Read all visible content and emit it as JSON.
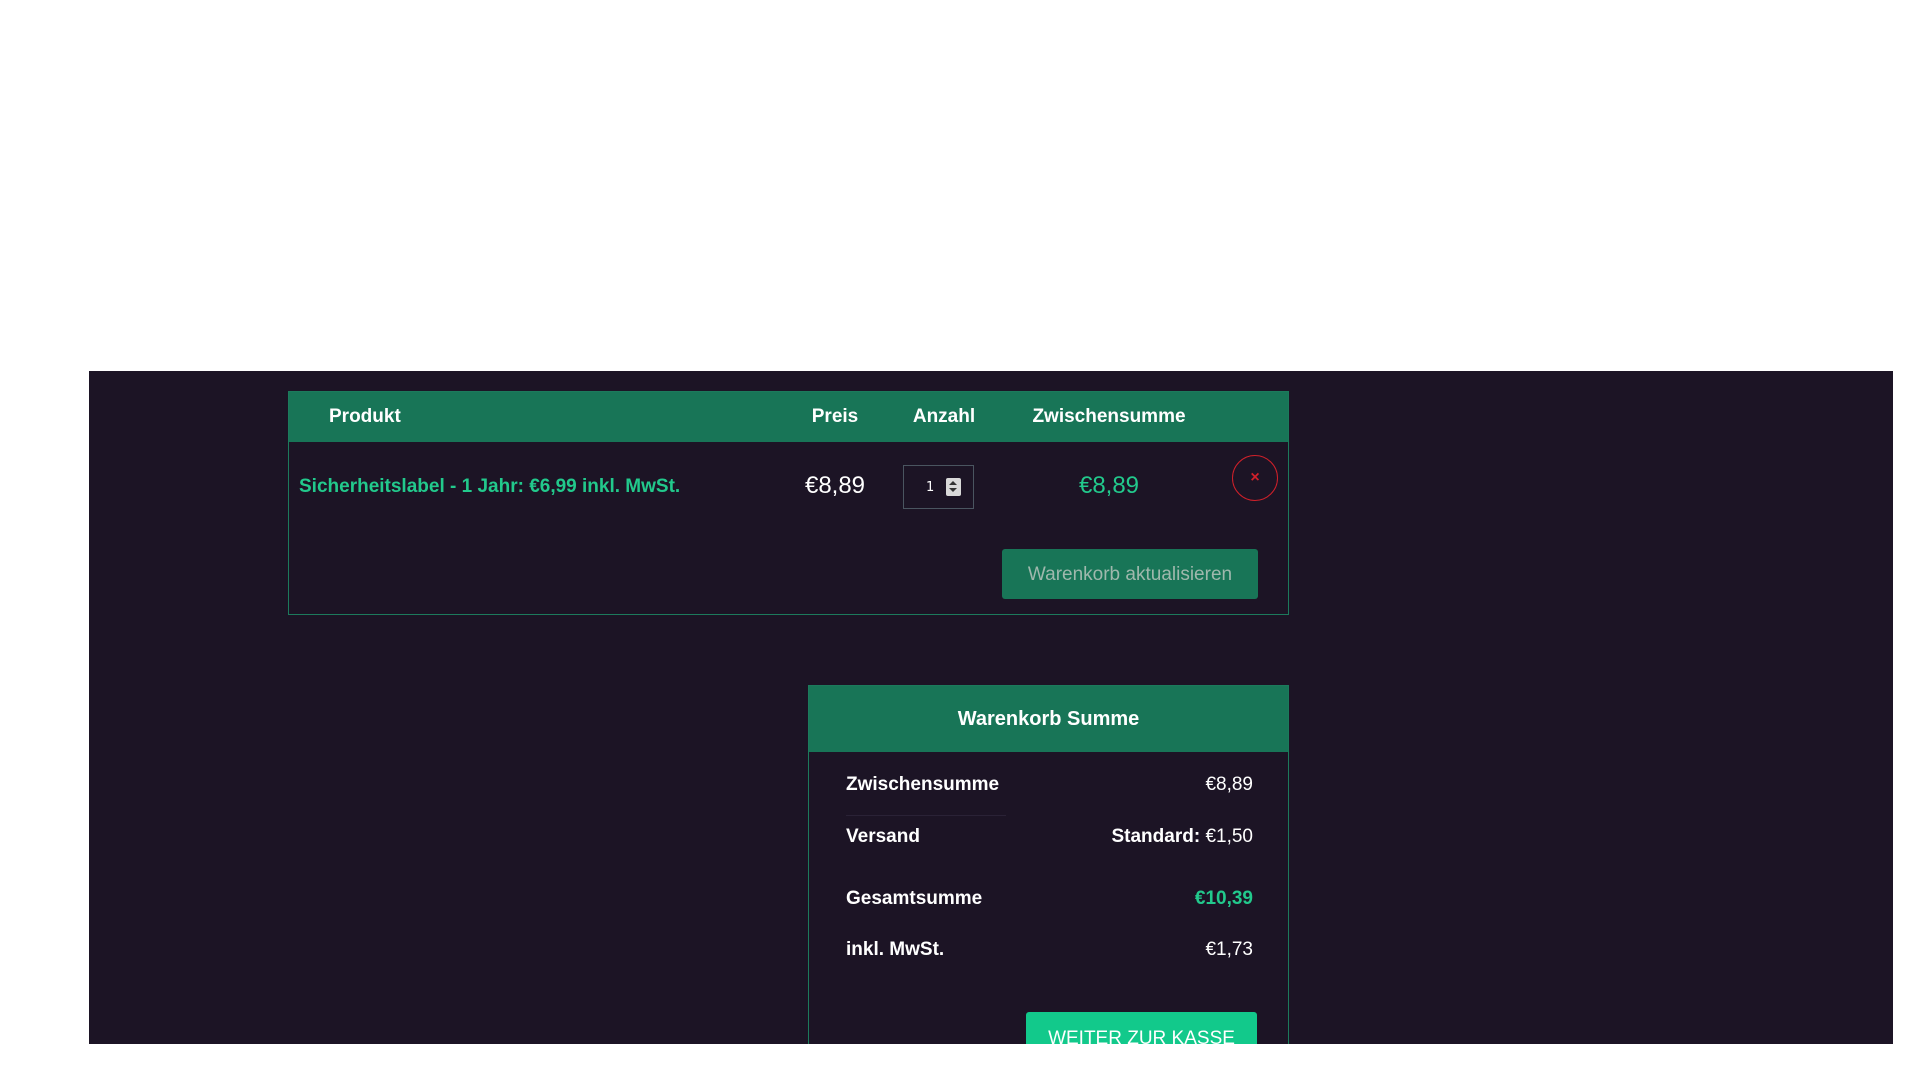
{
  "cart": {
    "headers": {
      "product": "Produkt",
      "price": "Preis",
      "quantity": "Anzahl",
      "subtotal": "Zwischensumme"
    },
    "items": [
      {
        "name": "Sicherheitslabel - 1 Jahr: €6,99 inkl. MwSt.",
        "price": "€8,89",
        "quantity": "1",
        "subtotal": "€8,89",
        "remove_label": "×"
      }
    ],
    "update_button_label": "Warenkorb aktualisieren"
  },
  "totals": {
    "title": "Warenkorb Summe",
    "subtotal_label": "Zwischensumme",
    "subtotal_value": "€8,89",
    "shipping_label": "Versand",
    "shipping_method": "Standard:",
    "shipping_value": "€1,50",
    "total_label": "Gesamtsumme",
    "total_value": "€10,39",
    "tax_label": "inkl. MwSt.",
    "tax_value": "€1,73",
    "checkout_button_label": "WEITER ZUR KASSE"
  },
  "colors": {
    "background_dark": "#1c1425",
    "header_green": "#187557",
    "accent_green": "#22c98c",
    "checkout_green": "#12c98b",
    "remove_red": "#d0202a"
  }
}
